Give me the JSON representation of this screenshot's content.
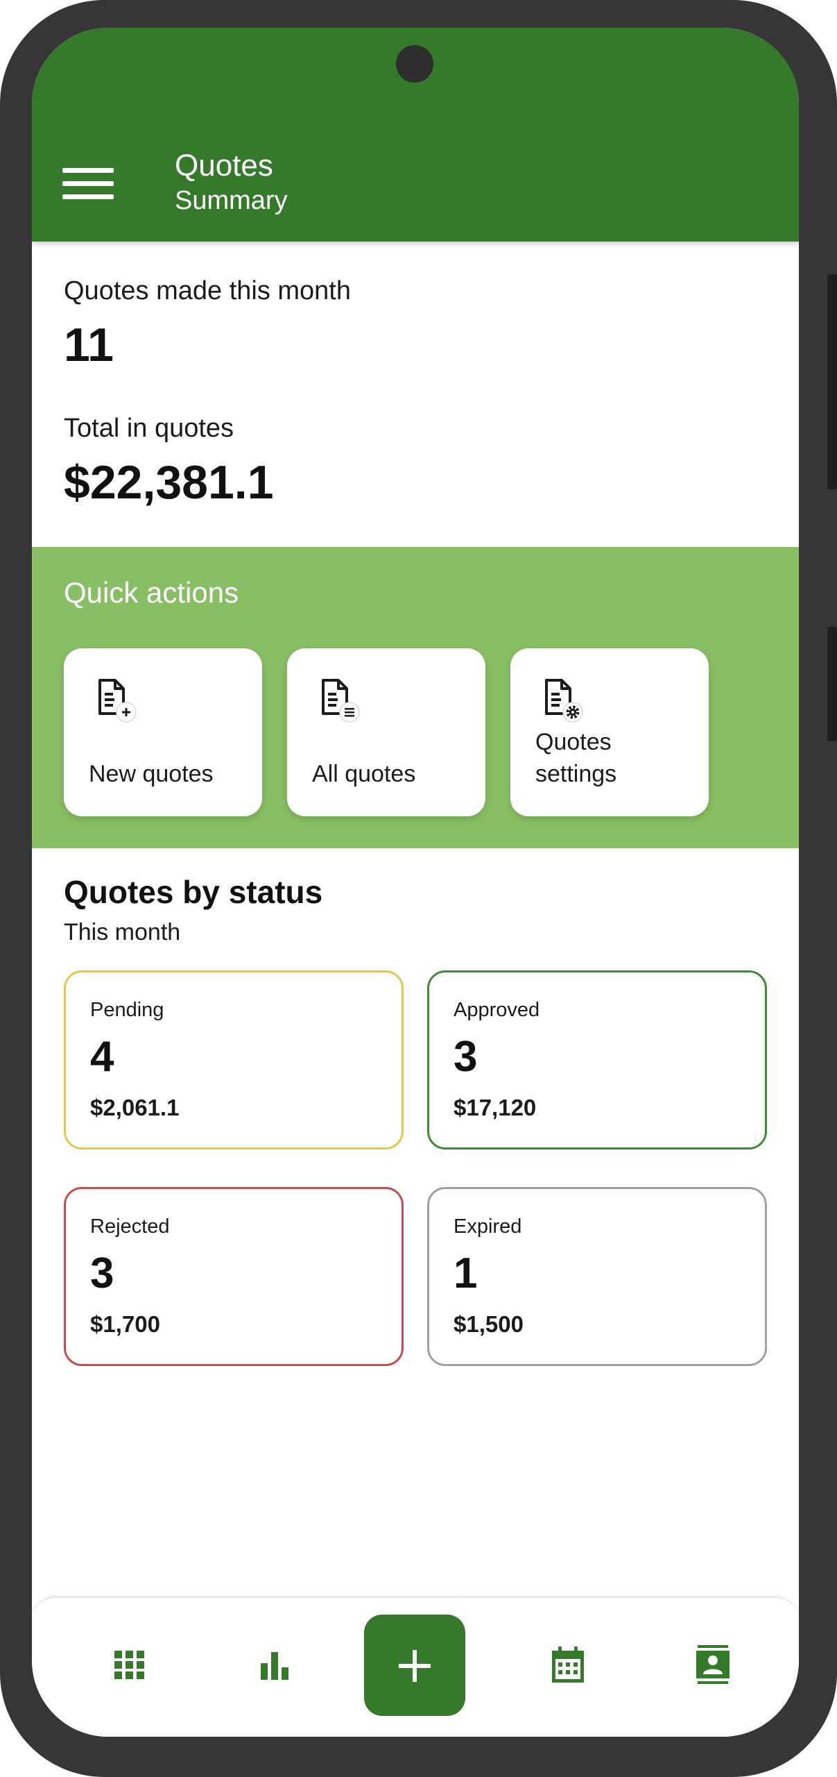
{
  "header": {
    "title": "Quotes",
    "subtitle": "Summary"
  },
  "stats": {
    "quotes_label": "Quotes made this month",
    "quotes_value": "11",
    "total_label": "Total in quotes",
    "total_value": "$22,381.1"
  },
  "quick_actions": {
    "title": "Quick actions",
    "items": [
      {
        "label": "New quotes",
        "icon": "document-add-icon"
      },
      {
        "label": "All quotes",
        "icon": "document-list-icon"
      },
      {
        "label": "Quotes settings",
        "icon": "document-settings-icon"
      }
    ]
  },
  "status": {
    "title": "Quotes by status",
    "subtitle": "This month",
    "cards": [
      {
        "name": "Pending",
        "count": "4",
        "amount": "$2,061.1",
        "color": "#e7c64d"
      },
      {
        "name": "Approved",
        "count": "3",
        "amount": "$17,120",
        "color": "#3f8a34"
      },
      {
        "name": "Rejected",
        "count": "3",
        "amount": "$1,700",
        "color": "#c94b4b"
      },
      {
        "name": "Expired",
        "count": "1",
        "amount": "$1,500",
        "color": "#a0a0a0"
      }
    ]
  },
  "nav": {
    "items": [
      "grid-icon",
      "bar-chart-icon",
      "plus-icon",
      "calendar-icon",
      "contacts-icon"
    ]
  },
  "colors": {
    "primary": "#357a2a",
    "accent_light": "#88be64"
  }
}
